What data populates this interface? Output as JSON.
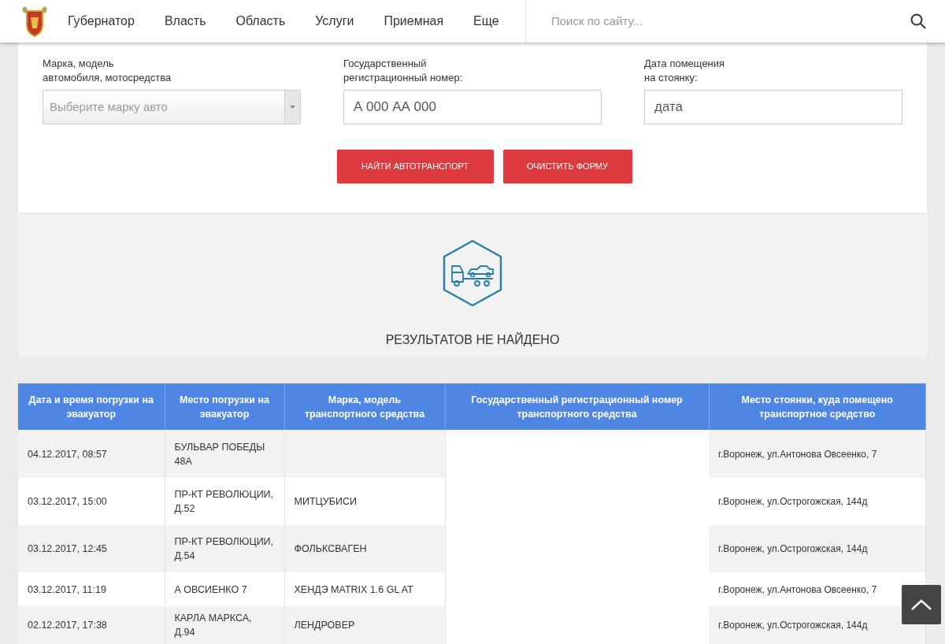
{
  "nav": {
    "items": [
      {
        "label": "Губернатор"
      },
      {
        "label": "Власть"
      },
      {
        "label": "Область"
      },
      {
        "label": "Услуги"
      },
      {
        "label": "Приемная"
      },
      {
        "label": "Еще"
      }
    ],
    "search": {
      "placeholder": "Поиск по сайту..."
    }
  },
  "form": {
    "fields": [
      {
        "kind": "select",
        "label": "Марка, модель\nавтомобиля, мотосредства",
        "placeholder": "Выберите марку авто"
      },
      {
        "kind": "text",
        "label": "Государственный\nрегистрационный номер:",
        "placeholder": "А 000 АА 000"
      },
      {
        "kind": "text",
        "label": "Дата помещения\nна стоянку:",
        "placeholder": "дата"
      }
    ],
    "buttons": [
      "НАЙТИ АВТОТРАНСПОРТ",
      "ОЧИСТИТЬ ФОРМУ"
    ]
  },
  "results": {
    "message": "РЕЗУЛЬТАТОВ НЕ НАЙДЕНО"
  },
  "table": {
    "columns": [
      "Дата и время погрузки на эвакуатор",
      "Место погрузки на эвакуатор",
      "Марка, модель транспортного средства",
      "Государственный регистрационный номер транспортного средства",
      "Место стоянки, куда помещено транспортное средство"
    ],
    "rows": [
      {
        "datetime": "04.12.2017, 08:57",
        "place": "БУЛЬВАР ПОБЕДЫ 48А",
        "parking": "г.Воронеж, ул.Антонова Овсеенко, 7"
      },
      {
        "datetime": "03.12.2017, 15:00",
        "place": "ПР-КТ РЕВОЛЮЦИИ, Д.52",
        "brand": "МИТЦУБИСИ",
        "parking": "г.Воронеж, ул.Острогожская, 144д"
      },
      {
        "datetime": "03.12.2017, 12:45",
        "place": "ПР-КТ РЕВОЛЮЦИИ, Д.54",
        "brand": "ФОЛЬКСВАГЕН",
        "parking": "г.Воронеж, ул.Острогожская, 144д"
      },
      {
        "datetime": "03.12.2017, 11:19",
        "place": "А ОВСИЕНКО 7",
        "brand": "ХЕНДЭ MATRIX 1.6 GL AT",
        "parking": "г.Воронеж, ул.Антонова Овсеенко, 7"
      },
      {
        "datetime": "02.12.2017, 17:38",
        "place": "КАРЛА МАРКСА, Д.94",
        "brand": "ЛЕНДРОВЕР",
        "parking": "г.Воронеж, ул.Острогожская, 144д"
      }
    ]
  }
}
